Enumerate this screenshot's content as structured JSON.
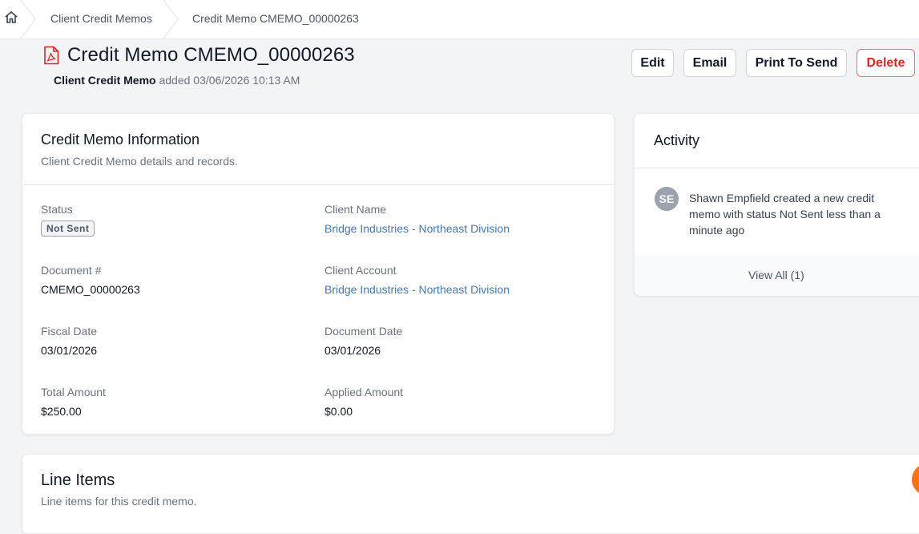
{
  "breadcrumb": {
    "items": [
      "Client Credit Memos",
      "Credit Memo CMEMO_00000263"
    ]
  },
  "header": {
    "title": "Credit Memo CMEMO_00000263",
    "subtitle_strong": "Client Credit Memo",
    "subtitle_rest": " added 03/06/2026 10:13 AM"
  },
  "actions": {
    "edit": "Edit",
    "email": "Email",
    "print": "Print To Send",
    "delete": "Delete"
  },
  "info": {
    "title": "Credit Memo Information",
    "description": "Client Credit Memo details and records.",
    "status_label": "Status",
    "status_value": "Not Sent",
    "client_name_label": "Client Name",
    "client_name_value": "Bridge Industries - Northeast Division",
    "document_label": "Document #",
    "document_value": "CMEMO_00000263",
    "client_account_label": "Client Account",
    "client_account_value": "Bridge Industries - Northeast Division",
    "fiscal_date_label": "Fiscal Date",
    "fiscal_date_value": "03/01/2026",
    "document_date_label": "Document Date",
    "document_date_value": "03/01/2026",
    "total_amount_label": "Total Amount",
    "total_amount_value": "$250.00",
    "applied_amount_label": "Applied Amount",
    "applied_amount_value": "$0.00"
  },
  "activity": {
    "title": "Activity",
    "avatar_initials": "SE",
    "entry_text": "Shawn Empfield created a new credit memo with status Not Sent less than a minute ago",
    "view_all": "View All (1)"
  },
  "line_items": {
    "title": "Line Items",
    "description": "Line items for this credit memo."
  },
  "colors": {
    "link": "#4a78a8",
    "delete": "#dc2626",
    "pdf_icon": "#dc2626",
    "fab": "#f97316"
  }
}
